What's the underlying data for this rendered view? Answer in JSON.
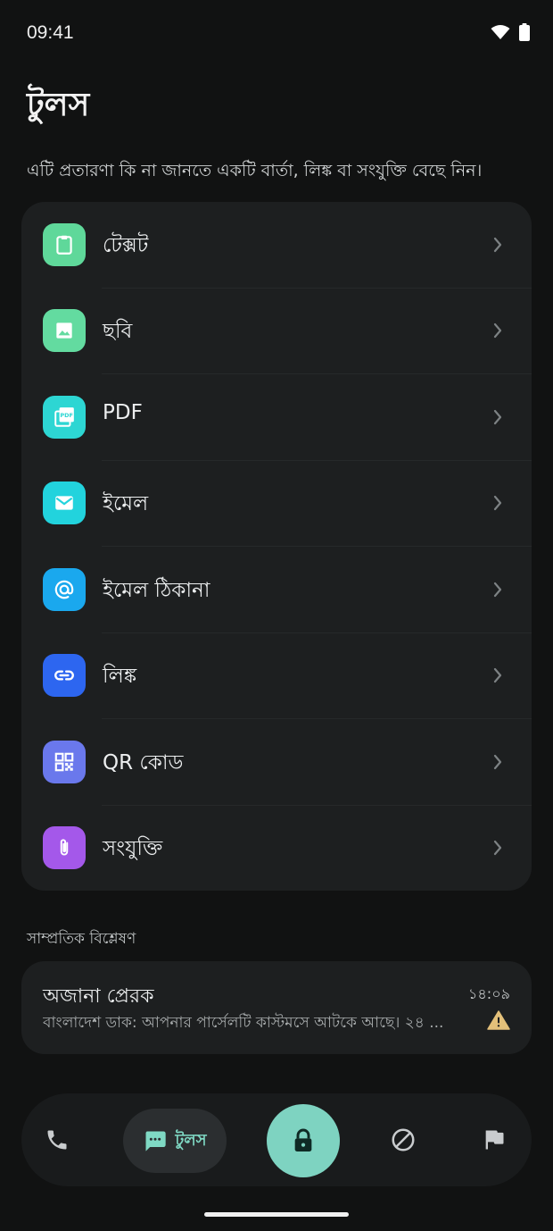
{
  "status_bar": {
    "time": "09:41"
  },
  "header": {
    "title": "টুলস",
    "subtitle": "এটি প্রতারণা কি না জানতে একটি বার্তা, লিঙ্ক বা সংযুক্তি বেছে নিন।"
  },
  "tools": [
    {
      "label": "টেক্সট",
      "icon": "clipboard-icon",
      "color": "#5fd89a"
    },
    {
      "label": "ছবি",
      "icon": "image-icon",
      "color": "#63dba0"
    },
    {
      "label": "PDF",
      "icon": "pdf-icon",
      "color": "#2dd6d3"
    },
    {
      "label": "ইমেল",
      "icon": "mail-icon",
      "color": "#22d3dd"
    },
    {
      "label": "ইমেল ঠিকানা",
      "icon": "at-icon",
      "color": "#1aa8ee"
    },
    {
      "label": "লিঙ্ক",
      "icon": "link-icon",
      "color": "#2d66f0"
    },
    {
      "label": "QR কোড",
      "icon": "qr-code-icon",
      "color": "#6a78ec"
    },
    {
      "label": "সংযুক্তি",
      "icon": "paperclip-icon",
      "color": "#a458ea"
    }
  ],
  "recent": {
    "section_label": "সাম্প্রতিক বিশ্লেষণ",
    "items": [
      {
        "sender": "অজানা প্রেরক",
        "time": "১৪:০৯",
        "preview": "বাংলাদেশ ডাক: আপনার পার্সেলটি কাস্টমসে আটকে আছে। ২৪ ...",
        "status_icon": "warning-icon",
        "status_color": "#e3c07a"
      }
    ]
  },
  "bottom_nav": {
    "items": [
      {
        "name": "phone",
        "icon": "phone-icon"
      },
      {
        "name": "tools",
        "icon": "message-icon",
        "label": "টুলস",
        "active": true
      },
      {
        "name": "lock",
        "icon": "lock-icon"
      },
      {
        "name": "block",
        "icon": "block-icon"
      },
      {
        "name": "report",
        "icon": "flag-icon"
      }
    ],
    "accent": "#7ed3c1"
  }
}
